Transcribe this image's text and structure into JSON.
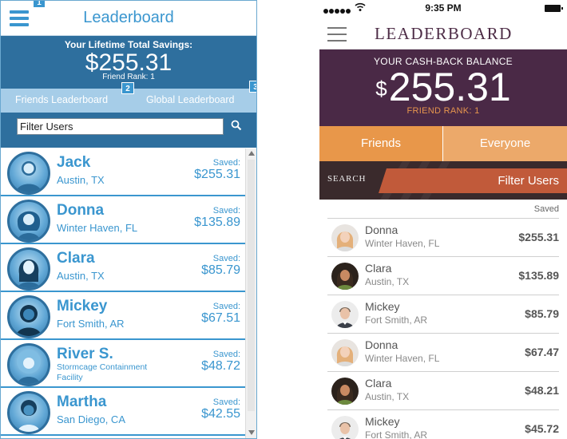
{
  "left": {
    "title": "Leaderboard",
    "markers": [
      "1",
      "2",
      "3"
    ],
    "savings_label": "Your Lifetime Total Savings:",
    "savings_amount": "$255.31",
    "friend_rank": "Friend Rank: 1",
    "tabs": [
      "Friends Leaderboard",
      "Global Leaderboard"
    ],
    "search_value": "Filter Users",
    "rows": [
      {
        "name": "Jack",
        "location": "Austin, TX",
        "saved_label": "Saved:",
        "saved": "$255.31"
      },
      {
        "name": "Donna",
        "location": "Winter Haven, FL",
        "saved_label": "Saved:",
        "saved": "$135.89"
      },
      {
        "name": "Clara",
        "location": "Austin, TX",
        "saved_label": "Saved:",
        "saved": "$85.79"
      },
      {
        "name": "Mickey",
        "location": "Fort Smith, AR",
        "saved_label": "Saved:",
        "saved": "$67.51"
      },
      {
        "name": "River S.",
        "location": "Stormcage Containment Facility",
        "saved_label": "Saved:",
        "saved": "$48.72"
      },
      {
        "name": "Martha",
        "location": "San Diego, CA",
        "saved_label": "Saved:",
        "saved": "$42.55"
      }
    ],
    "colors": {
      "primary": "#3a96cf",
      "dark": "#2e6f9e",
      "tab_bar": "#a6cde8"
    }
  },
  "right": {
    "status_time": "9:35 PM",
    "title": "LEADERBOARD",
    "balance_label": "YOUR CASH-BACK BALANCE",
    "currency": "$",
    "balance_amount": "255.31",
    "friend_rank": "FRIEND RANK: 1",
    "tabs": [
      "Friends",
      "Everyone"
    ],
    "search_label": "SEARCH",
    "filter_label": "Filter Users",
    "saved_header": "Saved",
    "rows": [
      {
        "name": "Donna",
        "location": "Winter Haven, FL",
        "saved": "$255.31"
      },
      {
        "name": "Clara",
        "location": "Austin, TX",
        "saved": "$135.89"
      },
      {
        "name": "Mickey",
        "location": "Fort Smith, AR",
        "saved": "$85.79"
      },
      {
        "name": "Donna",
        "location": "Winter Haven, FL",
        "saved": "$67.47"
      },
      {
        "name": "Clara",
        "location": "Austin, TX",
        "saved": "$48.21"
      },
      {
        "name": "Mickey",
        "location": "Fort Smith, AR",
        "saved": "$45.72"
      }
    ],
    "colors": {
      "plum": "#4a2946",
      "orange": "#e8974a",
      "orange_light": "#eca96a",
      "rank": "#e6954e",
      "filter": "#c15a3a"
    }
  }
}
